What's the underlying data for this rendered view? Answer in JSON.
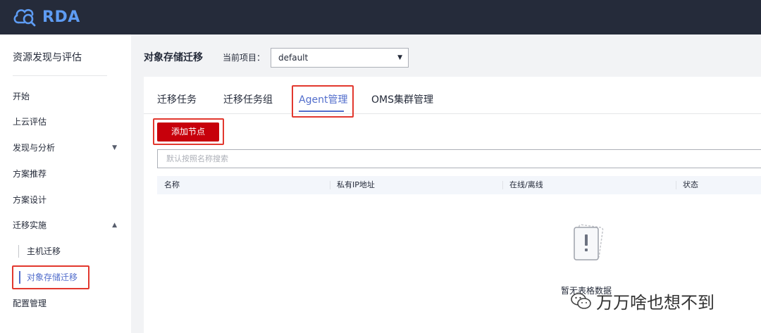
{
  "brand": {
    "name": "RDA",
    "color": "#5e9cf3"
  },
  "sidebar": {
    "title": "资源发现与评估",
    "items": [
      {
        "label": "开始"
      },
      {
        "label": "上云评估"
      },
      {
        "label": "发现与分析",
        "caret": "▼"
      },
      {
        "label": "方案推荐"
      },
      {
        "label": "方案设计"
      },
      {
        "label": "迁移实施",
        "caret": "▲"
      },
      {
        "label": "主机迁移"
      },
      {
        "label": "对象存储迁移",
        "active": true
      },
      {
        "label": "配置管理"
      }
    ]
  },
  "header": {
    "title": "对象存储迁移",
    "project_label": "当前项目：",
    "project_value": "default"
  },
  "tabs": [
    {
      "label": "迁移任务"
    },
    {
      "label": "迁移任务组"
    },
    {
      "label": "Agent管理",
      "active": true
    },
    {
      "label": "OMS集群管理"
    }
  ],
  "toolbar": {
    "add_button": "添加节点"
  },
  "search": {
    "placeholder": "默认按照名称搜索"
  },
  "table": {
    "columns": [
      "名称",
      "私有IP地址",
      "在线/离线",
      "状态"
    ],
    "rows": [],
    "empty_text": "暂无表格数据"
  },
  "watermark": {
    "text": "万万啥也想不到"
  },
  "colors": {
    "topbar": "#252b3a",
    "accent": "#526ecc",
    "primary_button": "#c7000b",
    "highlight_box": "#e2382e"
  }
}
